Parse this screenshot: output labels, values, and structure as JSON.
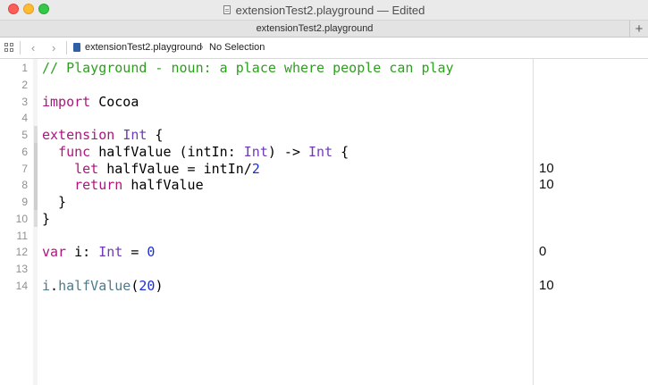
{
  "window": {
    "title": "extensionTest2.playground — Edited",
    "tab_label": "extensionTest2.playground",
    "add_tab_symbol": "+"
  },
  "jumpbar": {
    "back_symbol": "‹",
    "forward_symbol": "›",
    "file_name": "extensionTest2.playground",
    "separator": "›",
    "selection": "No Selection"
  },
  "colors": {
    "comment": "#2ca01d",
    "keyword": "#b0147c",
    "type": "#6f3ab8",
    "number": "#1d2ed8",
    "identifier": "#4d7a8a"
  },
  "editor": {
    "lines": [
      {
        "number": "1",
        "tokens": [
          {
            "t": "// Playground - noun: a place where people can play",
            "c": "comment"
          }
        ],
        "result": ""
      },
      {
        "number": "2",
        "tokens": [],
        "result": ""
      },
      {
        "number": "3",
        "tokens": [
          {
            "t": "import",
            "c": "keyword"
          },
          {
            "t": " Cocoa",
            "c": "plain"
          }
        ],
        "result": ""
      },
      {
        "number": "4",
        "tokens": [],
        "result": ""
      },
      {
        "number": "5",
        "tokens": [
          {
            "t": "extension",
            "c": "keyword"
          },
          {
            "t": " ",
            "c": "plain"
          },
          {
            "t": "Int",
            "c": "type"
          },
          {
            "t": " {",
            "c": "plain"
          }
        ],
        "result": ""
      },
      {
        "number": "6",
        "tokens": [
          {
            "t": "  ",
            "c": "plain"
          },
          {
            "t": "func",
            "c": "keyword"
          },
          {
            "t": " halfValue (intIn: ",
            "c": "plain"
          },
          {
            "t": "Int",
            "c": "type"
          },
          {
            "t": ") -> ",
            "c": "plain"
          },
          {
            "t": "Int",
            "c": "type"
          },
          {
            "t": " {",
            "c": "plain"
          }
        ],
        "result": ""
      },
      {
        "number": "7",
        "tokens": [
          {
            "t": "    ",
            "c": "plain"
          },
          {
            "t": "let",
            "c": "keyword"
          },
          {
            "t": " halfValue = intIn/",
            "c": "plain"
          },
          {
            "t": "2",
            "c": "number"
          }
        ],
        "result": "10"
      },
      {
        "number": "8",
        "tokens": [
          {
            "t": "    ",
            "c": "plain"
          },
          {
            "t": "return",
            "c": "keyword"
          },
          {
            "t": " halfValue",
            "c": "plain"
          }
        ],
        "result": "10"
      },
      {
        "number": "9",
        "tokens": [
          {
            "t": "  }",
            "c": "plain"
          }
        ],
        "result": ""
      },
      {
        "number": "10",
        "tokens": [
          {
            "t": "}",
            "c": "plain"
          }
        ],
        "result": ""
      },
      {
        "number": "11",
        "tokens": [],
        "result": ""
      },
      {
        "number": "12",
        "tokens": [
          {
            "t": "var",
            "c": "keyword"
          },
          {
            "t": " i: ",
            "c": "plain"
          },
          {
            "t": "Int",
            "c": "type"
          },
          {
            "t": " = ",
            "c": "plain"
          },
          {
            "t": "0",
            "c": "number"
          }
        ],
        "result": "0"
      },
      {
        "number": "13",
        "tokens": [],
        "result": ""
      },
      {
        "number": "14",
        "tokens": [
          {
            "t": "i",
            "c": "ident"
          },
          {
            "t": ".",
            "c": "plain"
          },
          {
            "t": "halfValue",
            "c": "ident"
          },
          {
            "t": "(",
            "c": "plain"
          },
          {
            "t": "20",
            "c": "number"
          },
          {
            "t": ")",
            "c": "plain"
          }
        ],
        "result": "10"
      }
    ]
  }
}
